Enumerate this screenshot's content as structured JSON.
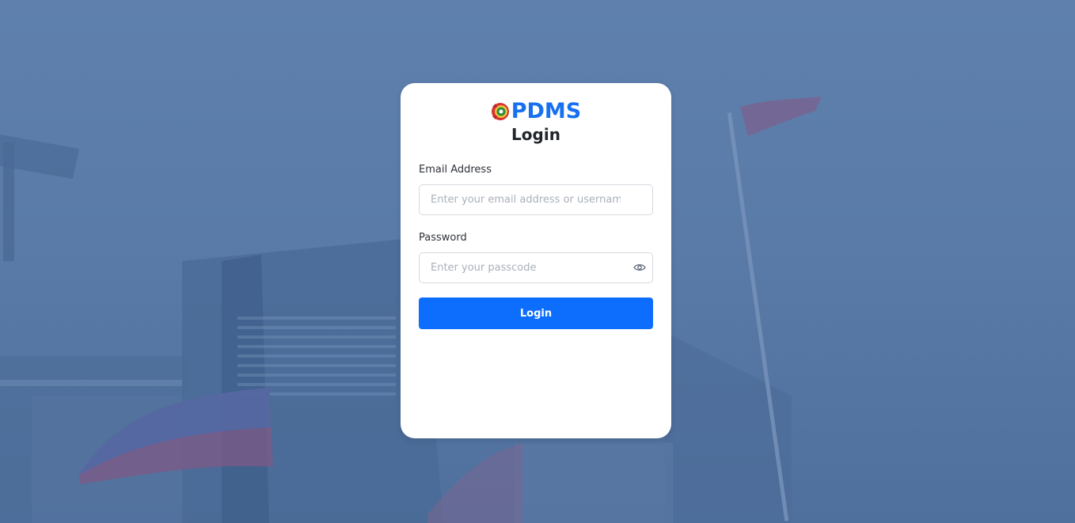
{
  "brand": {
    "name": "PDMS"
  },
  "login": {
    "title": "Login",
    "email_label": "Email Address",
    "email_placeholder": "Enter your email address or username",
    "email_value": "",
    "password_label": "Password",
    "password_placeholder": "Enter your passcode",
    "password_value": "",
    "submit_label": "Login"
  },
  "icons": {
    "logo": "pnp-seal-icon",
    "password_toggle": "eye-icon"
  },
  "colors": {
    "brand": "#1670f0",
    "button": "#0d6efd",
    "background_overlay": "#5a7ba8"
  }
}
